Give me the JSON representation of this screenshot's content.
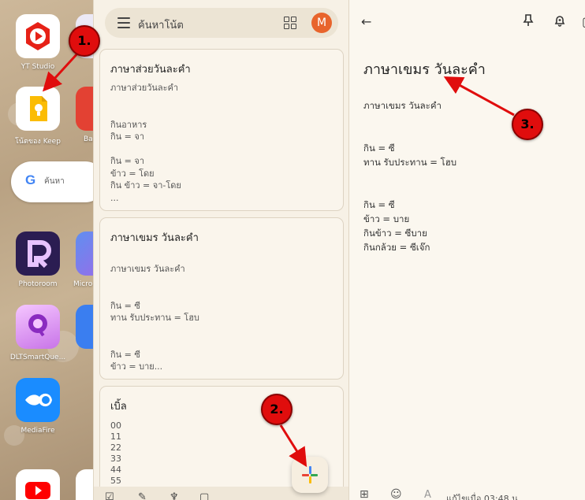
{
  "home": {
    "apps": [
      {
        "label": "YT Studio",
        "icon": "yt-studio-icon"
      },
      {
        "label": "โน้ตของ Keep",
        "icon": "keep-icon"
      },
      {
        "label": "Photoroom",
        "icon": "photoroom-icon"
      },
      {
        "label": "DLTSmartQue...",
        "icon": "dlt-icon"
      },
      {
        "label": "MediaFire",
        "icon": "mediafire-icon"
      }
    ],
    "peek_labels": [
      "Ba",
      "Micro"
    ],
    "search_placeholder": "ค้นหา"
  },
  "keep": {
    "search_placeholder": "ค้นหาโน้ต",
    "avatar_letter": "M",
    "notes": [
      {
        "title": "ภาษาส่วยวันละคำ",
        "lines": [
          "ภาษาส่วยวันละคำ",
          "",
          "",
          "กินอาหาร",
          "กิน  = จา",
          "",
          "กิน  = จา",
          "ข้าว = โดย",
          "กิน ข้าว = จา-โดย",
          "..."
        ]
      },
      {
        "title": "ภาษาเขมร วันละคำ",
        "lines": [
          "ภาษาเขมร วันละคำ",
          "",
          "",
          "กิน = ซี",
          "ทาน รับประทาน = โฮบ",
          "",
          "",
          "กิน = ซี",
          "ข้าว = บาย..."
        ]
      },
      {
        "title": "เบิ้ล",
        "lines": [
          "00",
          "11",
          "22",
          "33",
          "44",
          "55"
        ]
      }
    ]
  },
  "editor": {
    "title": "ภาษาเขมร วันละคำ",
    "lines": [
      "ภาษาเขมร วันละคำ",
      "",
      "",
      "กิน = ซี",
      "ทาน รับประทาน = โฮบ",
      "",
      "",
      "กิน = ซี",
      "ข้าว = บาย",
      "กินข้าว = ซีบาย",
      "กินกล้วย = ซีเจ๊ก"
    ],
    "edited_label": "แก้ไขเมื่อ 03:48 น."
  },
  "annotations": {
    "step1": "1.",
    "step2": "2.",
    "step3": "3."
  },
  "colors": {
    "annotation_red": "#e00d0d",
    "keep_background": "#f7f1e6",
    "avatar": "#e8642c"
  }
}
